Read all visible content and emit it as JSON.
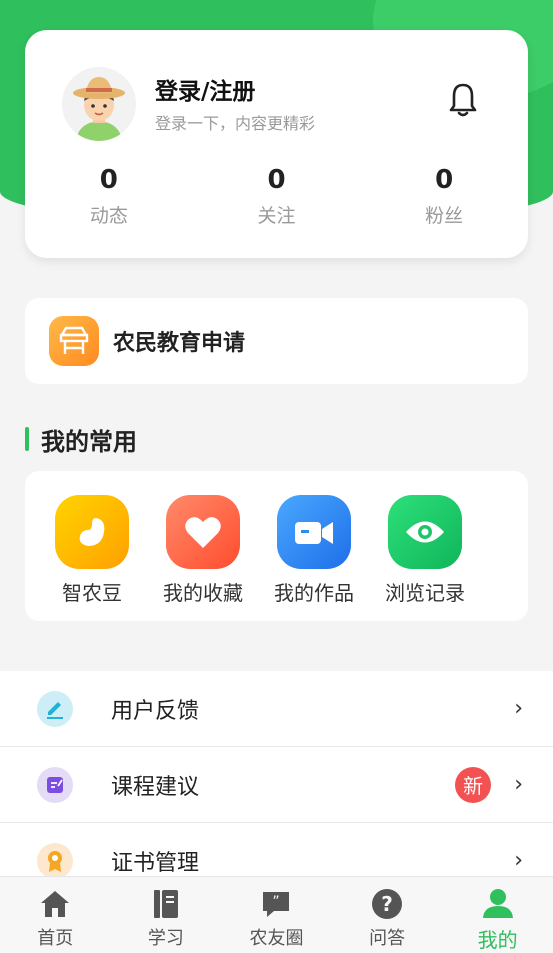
{
  "profile": {
    "title": "登录/注册",
    "subtitle": "登录一下，内容更精彩",
    "stats": [
      {
        "value": "0",
        "label": "动态"
      },
      {
        "value": "0",
        "label": "关注"
      },
      {
        "value": "0",
        "label": "粉丝"
      }
    ]
  },
  "edu": {
    "label": "农民教育申请"
  },
  "common": {
    "title": "我的常用",
    "items": [
      {
        "label": "智农豆",
        "icon": "bean-icon",
        "color": "#ffc107"
      },
      {
        "label": "我的收藏",
        "icon": "heart-icon",
        "color": "#ff6b4a"
      },
      {
        "label": "我的作品",
        "icon": "video-icon",
        "color": "#2d8cf0"
      },
      {
        "label": "浏览记录",
        "icon": "eye-icon",
        "color": "#1fc46a"
      }
    ]
  },
  "menu": [
    {
      "label": "用户反馈",
      "icon": "edit-icon",
      "chevron": "›"
    },
    {
      "label": "课程建议",
      "icon": "note-icon",
      "badge": "新",
      "chevron": "›"
    },
    {
      "label": "证书管理",
      "icon": "medal-icon",
      "chevron": "›"
    }
  ],
  "tabs": [
    {
      "label": "首页",
      "icon": "home-icon"
    },
    {
      "label": "学习",
      "icon": "book-icon"
    },
    {
      "label": "农友圈",
      "icon": "chat-icon"
    },
    {
      "label": "问答",
      "icon": "question-icon"
    },
    {
      "label": "我的",
      "icon": "user-icon",
      "active": true
    }
  ],
  "colors": {
    "accent": "#2fbf5c",
    "badge": "#f25252"
  }
}
